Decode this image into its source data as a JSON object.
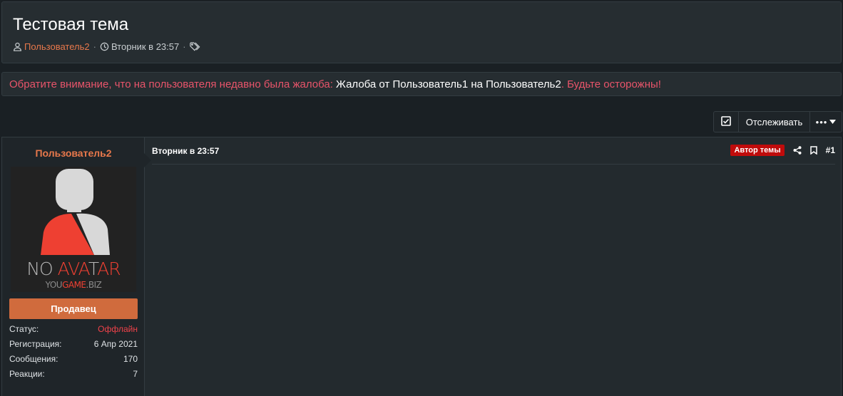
{
  "thread": {
    "title": "Тестовая тема",
    "author": "Пользователь2",
    "date": "Вторник в 23:57",
    "separator": "·"
  },
  "notice": {
    "prefix": "Обратите внимание, что на пользователя недавно была жалоба:",
    "link": "Жалоба от Пользователь1 на Пользователь2",
    "suffix": ". Будьте осторожны!"
  },
  "actions": {
    "watch_label": "Отслеживать",
    "more_label": "•••"
  },
  "post": {
    "username": "Пользователь2",
    "avatar": {
      "line1_a": "NO ",
      "line1_b": "AVA",
      "line1_c": "T",
      "line1_d": "AR",
      "line2_a": "YOU",
      "line2_b": "GAME",
      "line2_c": ".BIZ"
    },
    "user_title": "Продавец",
    "stats": [
      {
        "label": "Статус:",
        "value": "Оффлайн"
      },
      {
        "label": "Регистрация:",
        "value": "6 Апр 2021"
      },
      {
        "label": "Сообщения:",
        "value": "170"
      },
      {
        "label": "Реакции:",
        "value": "7"
      }
    ],
    "date": "Вторник в 23:57",
    "author_badge": "Автор темы",
    "number": "#1"
  },
  "colors": {
    "accent": "#e8784b",
    "warning": "#e8546a",
    "badge_red": "#c00b0b",
    "user_title_bg": "#d06b3d",
    "offline": "#f0424a"
  },
  "icons": {
    "author": "user-icon",
    "date": "clock-icon",
    "tags": "tags-icon",
    "watch": "checkbox-icon",
    "more": "chevron-down-icon",
    "share": "share-icon",
    "bookmark": "bookmark-icon"
  }
}
